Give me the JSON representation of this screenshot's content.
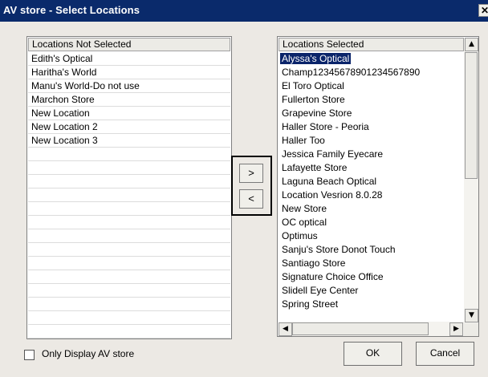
{
  "window": {
    "title": "AV store - Select Locations",
    "close_glyph": "✕"
  },
  "left_list": {
    "header": "Locations Not Selected",
    "items": [
      "Edith's Optical",
      "Haritha's World",
      "Manu's World-Do not use",
      "Marchon Store",
      "New Location",
      "New Location 2",
      "New Location 3",
      "",
      "",
      "",
      "",
      "",
      "",
      "",
      "",
      "",
      "",
      "",
      "",
      "",
      "",
      ""
    ]
  },
  "move_buttons": {
    "add": ">",
    "remove": "<"
  },
  "right_list": {
    "header": "Locations Selected",
    "selected_item": "Alyssa's Optical",
    "items": [
      "Champ12345678901234567890",
      "El Toro Optical",
      "Fullerton Store",
      "Grapevine Store",
      "Haller Store - Peoria",
      "Haller Too",
      "Jessica Family Eyecare",
      "Lafayette Store",
      "Laguna Beach Optical",
      "Location Vesrion 8.0.28",
      "New Store",
      "OC optical",
      "Optimus",
      "Sanju's Store Donot Touch",
      "Santiago Store",
      "Signature Choice Office",
      "Slidell Eye Center",
      "Spring Street"
    ],
    "scroll_icons": {
      "up": "up-arrow-icon",
      "down": "down-arrow-icon",
      "left": "left-arrow-icon",
      "right": "right-arrow-icon"
    }
  },
  "footer": {
    "checkbox_label": "Only Display AV store",
    "checkbox_checked": false,
    "ok_label": "OK",
    "cancel_label": "Cancel"
  },
  "colors": {
    "titlebar": "#0a2a6b",
    "dialog_bg": "#ece9e4",
    "selection": "#0a246a"
  }
}
